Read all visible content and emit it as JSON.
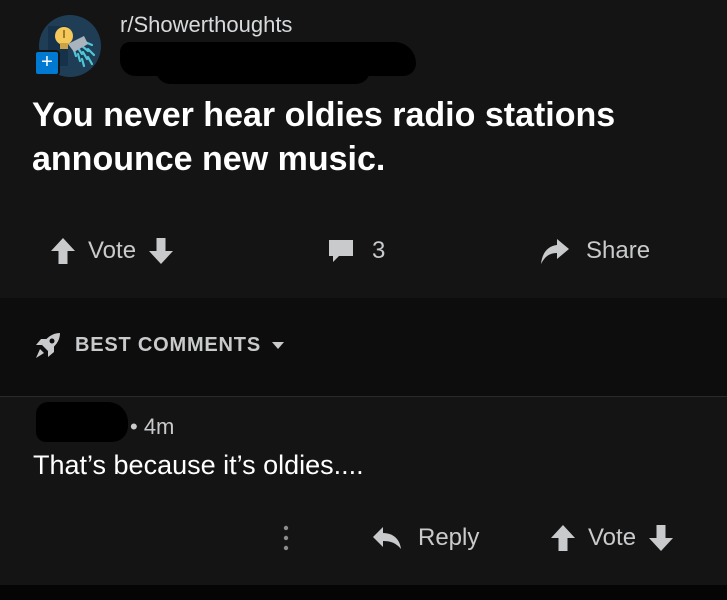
{
  "colors": {
    "background": "#141414",
    "sort_bar_background": "#0d0d0d",
    "text_primary": "#ffffff",
    "text_secondary": "#c8cacc",
    "accent_badge": "#0079d3",
    "subreddit_icon_bg": "#1f3e56",
    "subreddit_icon_accent": "#4ec8d8",
    "bulb_color": "#f5c85a"
  },
  "post": {
    "subreddit": "r/Showerthoughts",
    "subreddit_icon": "shower-lightbulb-icon",
    "join_icon": "plus-icon",
    "title": "You never hear oldies radio stations announce new music.",
    "vote_label": "Vote",
    "comment_count": "3",
    "share_label": "Share"
  },
  "sort": {
    "label": "BEST COMMENTS",
    "icon": "rocket-icon",
    "dropdown_icon": "caret-down-icon"
  },
  "comment": {
    "meta": "• 4m",
    "text": "That’s because it’s oldies....",
    "reply_label": "Reply",
    "vote_label": "Vote",
    "more_icon": "more-vertical-icon"
  }
}
